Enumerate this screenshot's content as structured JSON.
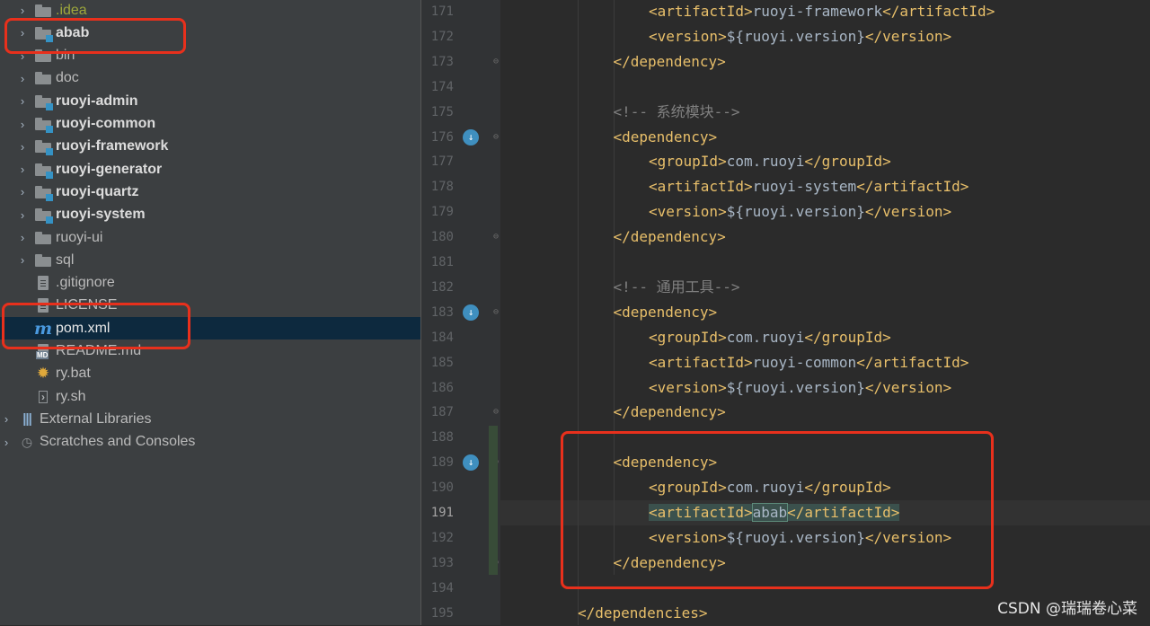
{
  "tree": {
    "items": [
      {
        "label": ".idea",
        "icon": "folder-icon",
        "chevron": "›",
        "style": "idea",
        "top": 0
      },
      {
        "label": "abab",
        "icon": "module-folder-icon",
        "chevron": "›",
        "style": "bold"
      },
      {
        "label": "bin",
        "icon": "folder-icon",
        "chevron": "›",
        "style": ""
      },
      {
        "label": "doc",
        "icon": "folder-icon",
        "chevron": "›",
        "style": ""
      },
      {
        "label": "ruoyi-admin",
        "icon": "module-folder-icon",
        "chevron": "›",
        "style": "bold"
      },
      {
        "label": "ruoyi-common",
        "icon": "module-folder-icon",
        "chevron": "›",
        "style": "bold"
      },
      {
        "label": "ruoyi-framework",
        "icon": "module-folder-icon",
        "chevron": "›",
        "style": "bold"
      },
      {
        "label": "ruoyi-generator",
        "icon": "module-folder-icon",
        "chevron": "›",
        "style": "bold"
      },
      {
        "label": "ruoyi-quartz",
        "icon": "module-folder-icon",
        "chevron": "›",
        "style": "bold"
      },
      {
        "label": "ruoyi-system",
        "icon": "module-folder-icon",
        "chevron": "›",
        "style": "bold"
      },
      {
        "label": "ruoyi-ui",
        "icon": "folder-icon",
        "chevron": "›",
        "style": ""
      },
      {
        "label": "sql",
        "icon": "folder-icon",
        "chevron": "›",
        "style": ""
      },
      {
        "label": ".gitignore",
        "icon": "gitignore-file-icon",
        "chevron": "",
        "style": ""
      },
      {
        "label": "LICENSE",
        "icon": "text-file-icon",
        "chevron": "",
        "style": ""
      },
      {
        "label": "pom.xml",
        "icon": "maven-icon",
        "chevron": "",
        "style": "sel"
      },
      {
        "label": "README.md",
        "icon": "markdown-file-icon",
        "chevron": "",
        "style": ""
      },
      {
        "label": "ry.bat",
        "icon": "bat-file-icon",
        "chevron": "",
        "style": ""
      },
      {
        "label": "ry.sh",
        "icon": "shell-file-icon",
        "chevron": "",
        "style": ""
      },
      {
        "label": "External Libraries",
        "icon": "libraries-icon",
        "chevron": "›",
        "style": "root"
      },
      {
        "label": "Scratches and Consoles",
        "icon": "scratches-icon",
        "chevron": "›",
        "style": "root"
      }
    ]
  },
  "editor": {
    "current_line": "191",
    "lines": [
      {
        "n": "171",
        "indent": 2,
        "parts": [
          [
            "tag",
            "<artifactId>"
          ],
          [
            "txt",
            "ruoyi-framework"
          ],
          [
            "tag",
            "</artifactId>"
          ]
        ]
      },
      {
        "n": "172",
        "indent": 2,
        "parts": [
          [
            "tag",
            "<version>"
          ],
          [
            "txt",
            "${ruoyi.version}"
          ],
          [
            "tag",
            "</version>"
          ]
        ]
      },
      {
        "n": "173",
        "indent": 1,
        "parts": [
          [
            "tag",
            "</dependency>"
          ]
        ]
      },
      {
        "n": "174",
        "indent": 0,
        "parts": []
      },
      {
        "n": "175",
        "indent": 1,
        "parts": [
          [
            "cmt",
            "<!-- 系统模块-->"
          ]
        ]
      },
      {
        "n": "176",
        "indent": 1,
        "parts": [
          [
            "tag",
            "<dependency>"
          ]
        ]
      },
      {
        "n": "177",
        "indent": 2,
        "parts": [
          [
            "tag",
            "<groupId>"
          ],
          [
            "txt",
            "com.ruoyi"
          ],
          [
            "tag",
            "</groupId>"
          ]
        ]
      },
      {
        "n": "178",
        "indent": 2,
        "parts": [
          [
            "tag",
            "<artifactId>"
          ],
          [
            "txt",
            "ruoyi-system"
          ],
          [
            "tag",
            "</artifactId>"
          ]
        ]
      },
      {
        "n": "179",
        "indent": 2,
        "parts": [
          [
            "tag",
            "<version>"
          ],
          [
            "txt",
            "${ruoyi.version}"
          ],
          [
            "tag",
            "</version>"
          ]
        ]
      },
      {
        "n": "180",
        "indent": 1,
        "parts": [
          [
            "tag",
            "</dependency>"
          ]
        ]
      },
      {
        "n": "181",
        "indent": 0,
        "parts": []
      },
      {
        "n": "182",
        "indent": 1,
        "parts": [
          [
            "cmt",
            "<!-- 通用工具-->"
          ]
        ]
      },
      {
        "n": "183",
        "indent": 1,
        "parts": [
          [
            "tag",
            "<dependency>"
          ]
        ]
      },
      {
        "n": "184",
        "indent": 2,
        "parts": [
          [
            "tag",
            "<groupId>"
          ],
          [
            "txt",
            "com.ruoyi"
          ],
          [
            "tag",
            "</groupId>"
          ]
        ]
      },
      {
        "n": "185",
        "indent": 2,
        "parts": [
          [
            "tag",
            "<artifactId>"
          ],
          [
            "txt",
            "ruoyi-common"
          ],
          [
            "tag",
            "</artifactId>"
          ]
        ]
      },
      {
        "n": "186",
        "indent": 2,
        "parts": [
          [
            "tag",
            "<version>"
          ],
          [
            "txt",
            "${ruoyi.version}"
          ],
          [
            "tag",
            "</version>"
          ]
        ]
      },
      {
        "n": "187",
        "indent": 1,
        "parts": [
          [
            "tag",
            "</dependency>"
          ]
        ]
      },
      {
        "n": "188",
        "indent": 0,
        "parts": []
      },
      {
        "n": "189",
        "indent": 1,
        "parts": [
          [
            "tag",
            "<dependency>"
          ]
        ]
      },
      {
        "n": "190",
        "indent": 2,
        "parts": [
          [
            "tag",
            "<groupId>"
          ],
          [
            "txt",
            "com.ruoyi"
          ],
          [
            "tag",
            "</groupId>"
          ]
        ]
      },
      {
        "n": "191",
        "indent": 2,
        "parts": [
          [
            "tag-hl",
            "<artifactId>"
          ],
          [
            "hl",
            "abab"
          ],
          [
            "tag-hl",
            "</artifactId>"
          ]
        ]
      },
      {
        "n": "192",
        "indent": 2,
        "parts": [
          [
            "tag",
            "<version>"
          ],
          [
            "txt",
            "${ruoyi.version}"
          ],
          [
            "tag",
            "</version>"
          ]
        ]
      },
      {
        "n": "193",
        "indent": 1,
        "parts": [
          [
            "tag",
            "</dependency>"
          ]
        ]
      },
      {
        "n": "194",
        "indent": 0,
        "parts": []
      },
      {
        "n": "195",
        "indent": 0,
        "parts": [
          [
            "tag",
            "</dependencies>"
          ]
        ]
      }
    ],
    "gutter_icon_lines": [
      "176",
      "183",
      "189"
    ],
    "fold_lines": [
      "173",
      "176",
      "180",
      "183",
      "187",
      "189",
      "193"
    ]
  },
  "watermark": "CSDN @瑞瑞卷心菜",
  "colors": {
    "tree_bg": "#3c3f41",
    "editor_bg": "#2b2b2b",
    "tag": "#e8bf6a",
    "text": "#a9b7c6",
    "comment": "#808080",
    "annotation": "#e8301c",
    "selection": "#0d293e"
  }
}
